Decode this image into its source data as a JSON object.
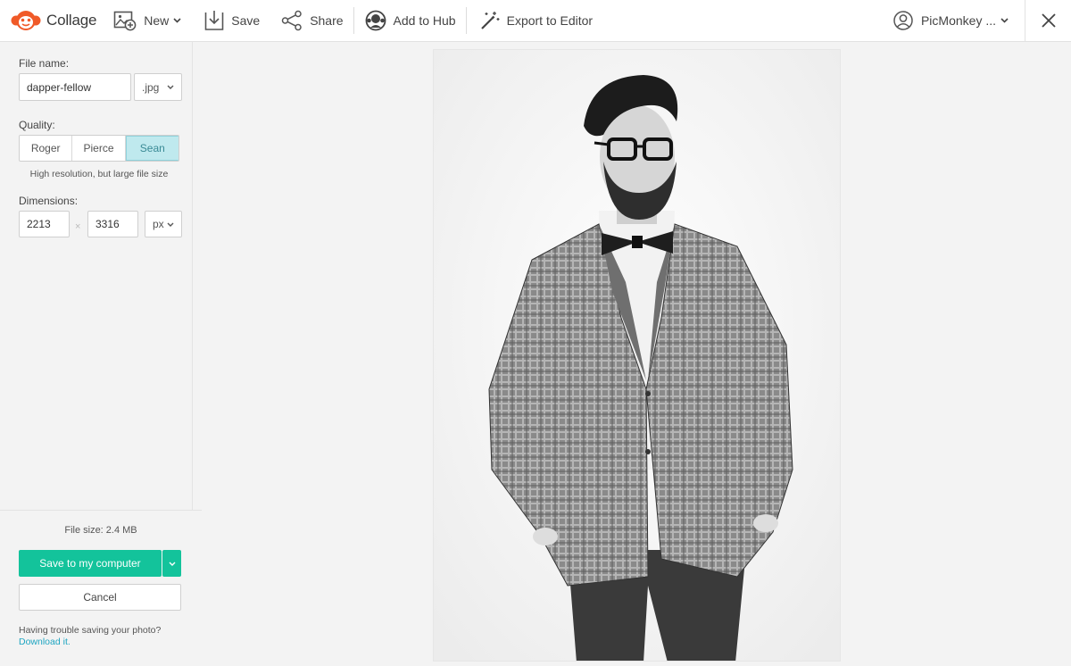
{
  "app": {
    "title": "Collage"
  },
  "toolbar": {
    "new_label": "New",
    "save_label": "Save",
    "share_label": "Share",
    "add_to_hub_label": "Add to Hub",
    "export_label": "Export to Editor"
  },
  "user": {
    "name": "PicMonkey ..."
  },
  "panel": {
    "file_name_label": "File name:",
    "file_name_value": "dapper-fellow",
    "file_type": ".jpg",
    "quality_label": "Quality:",
    "quality_options": [
      "Roger",
      "Pierce",
      "Sean"
    ],
    "quality_selected": "Sean",
    "quality_hint": "High resolution, but large file size",
    "dimensions_label": "Dimensions:",
    "width_value": "2213",
    "times_symbol": "×",
    "height_value": "3316",
    "unit": "px",
    "file_size_text": "File size:  2.4 MB",
    "save_button": "Save to my computer",
    "cancel_button": "Cancel",
    "trouble_text": "Having trouble saving your photo?",
    "download_link": "Download it."
  },
  "colors": {
    "brand": "#f05a28",
    "accent_green": "#13c39b",
    "selected_bg": "#bfe9ee",
    "link": "#1ea5c1"
  },
  "icons": [
    "monkey-logo-icon",
    "new-image-icon",
    "save-download-icon",
    "share-icon",
    "hub-icon",
    "magic-wand-icon",
    "user-avatar-icon",
    "close-icon",
    "chevron-down-icon"
  ]
}
